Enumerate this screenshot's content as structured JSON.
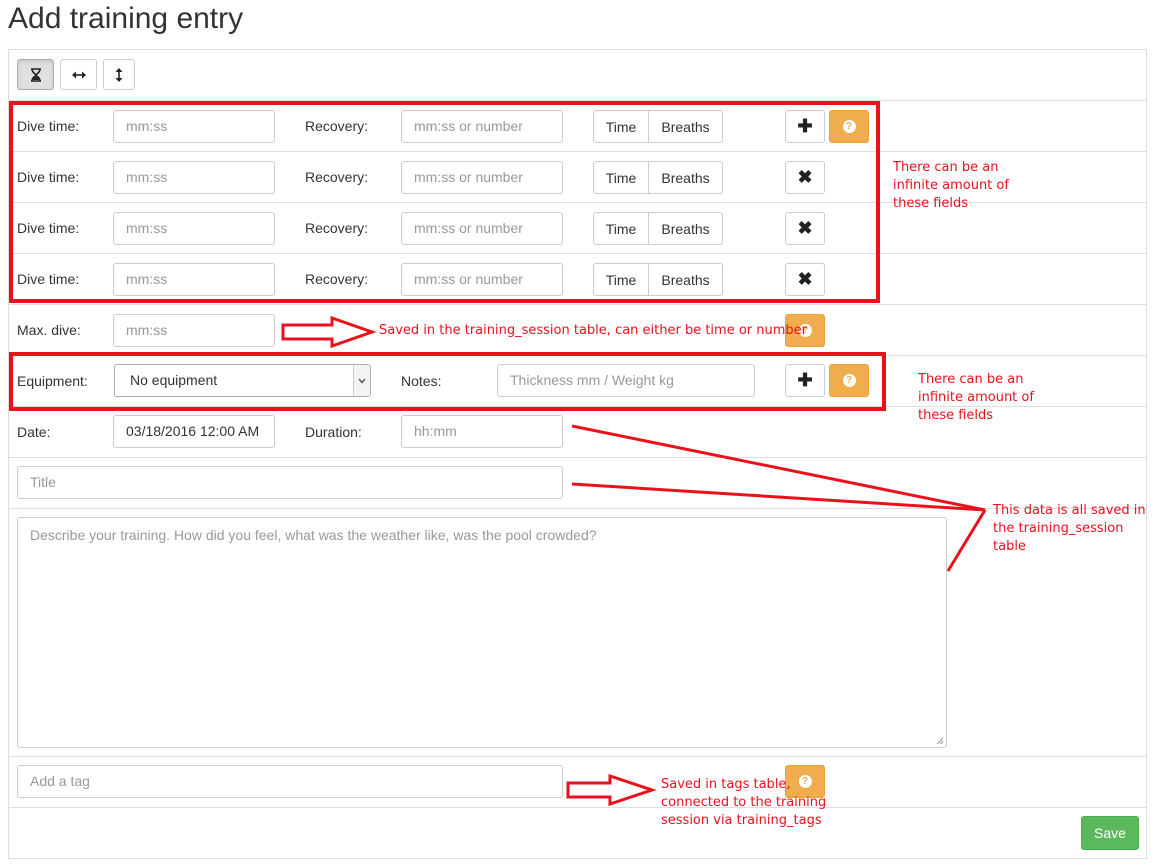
{
  "page": {
    "title": "Add training entry"
  },
  "toolbar": {
    "buttons": [
      {
        "name": "hourglass-icon",
        "active": true
      },
      {
        "name": "horizontal-arrows-icon",
        "active": false
      },
      {
        "name": "vertical-arrows-icon",
        "active": false
      }
    ]
  },
  "dive_rows": [
    {
      "dive_label": "Dive time:",
      "dive_placeholder": "mm:ss",
      "recovery_label": "Recovery:",
      "recovery_placeholder": "mm:ss or number",
      "time_label": "Time",
      "breaths_label": "Breaths",
      "action_icon": "plus-icon"
    },
    {
      "dive_label": "Dive time:",
      "dive_placeholder": "mm:ss",
      "recovery_label": "Recovery:",
      "recovery_placeholder": "mm:ss or number",
      "time_label": "Time",
      "breaths_label": "Breaths",
      "action_icon": "close-icon"
    },
    {
      "dive_label": "Dive time:",
      "dive_placeholder": "mm:ss",
      "recovery_label": "Recovery:",
      "recovery_placeholder": "mm:ss or number",
      "time_label": "Time",
      "breaths_label": "Breaths",
      "action_icon": "close-icon"
    },
    {
      "dive_label": "Dive time:",
      "dive_placeholder": "mm:ss",
      "recovery_label": "Recovery:",
      "recovery_placeholder": "mm:ss or number",
      "time_label": "Time",
      "breaths_label": "Breaths",
      "action_icon": "close-icon"
    }
  ],
  "max_dive": {
    "label": "Max. dive:",
    "placeholder": "mm:ss"
  },
  "equipment": {
    "label": "Equipment:",
    "selected": "No equipment",
    "notes_label": "Notes:",
    "notes_placeholder": "Thickness mm / Weight kg"
  },
  "date": {
    "label": "Date:",
    "value": "03/18/2016 12:00 AM",
    "duration_label": "Duration:",
    "duration_placeholder": "hh:mm"
  },
  "title_field": {
    "placeholder": "Title"
  },
  "description": {
    "placeholder": "Describe your training. How did you feel, what was the weather like, was the pool crowded?"
  },
  "tags": {
    "placeholder": "Add a tag"
  },
  "save_label": "Save",
  "annotations": {
    "dive_rows": [
      "There can be an",
      "infinite amount of",
      "these fields"
    ],
    "max_dive": "Saved in the training_session table, can either be time or number",
    "equipment": [
      "There can be an",
      "infinite amount of",
      "these fields"
    ],
    "session": [
      "This data is all saved in",
      "the training_session",
      "table"
    ],
    "tags": [
      "Saved in tags table,",
      "connected to the training",
      "session via training_tags"
    ]
  },
  "colors": {
    "annotation_red": "#e8111c",
    "warning": "#f0ad4e",
    "success": "#5cb85c"
  }
}
